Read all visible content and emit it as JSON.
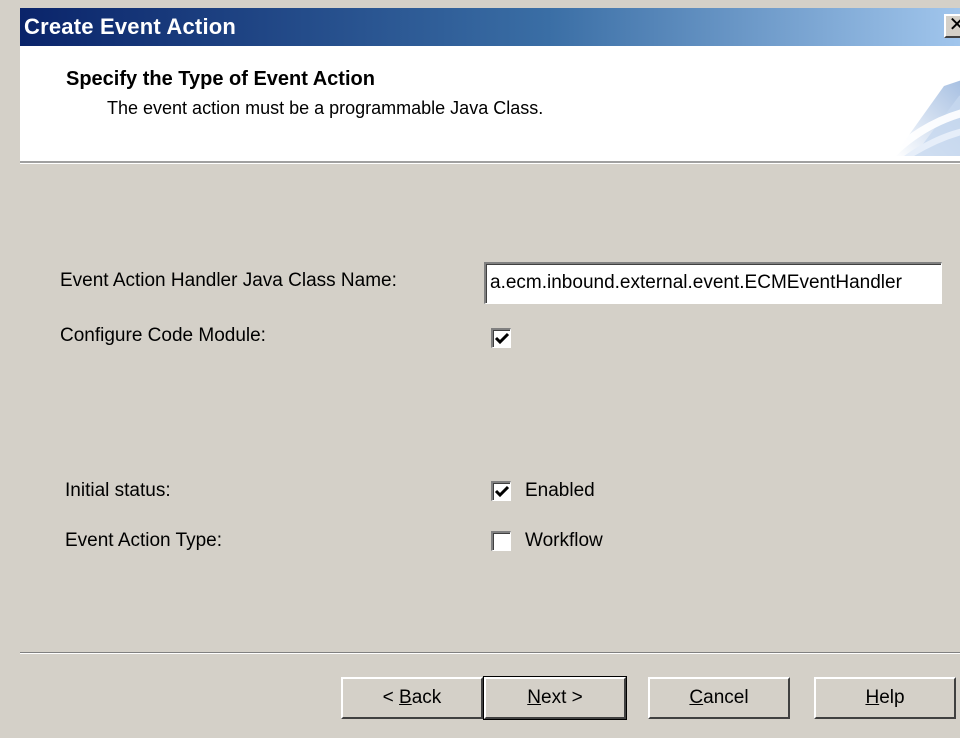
{
  "window": {
    "title": "Create Event Action",
    "close_glyph": "✕"
  },
  "header": {
    "title": "Specify the Type of Event Action",
    "subtitle": "The event action must be a programmable Java Class."
  },
  "form": {
    "handler_label": "Event Action Handler Java Class Name:",
    "handler_value": "a.ecm.inbound.external.event.ECMEventHandler",
    "configure_label": "Configure Code Module:",
    "configure_checked": true,
    "status_label": "Initial status:",
    "status_option_label": "Enabled",
    "status_checked": true,
    "type_label": "Event Action Type:",
    "type_option_label": "Workflow",
    "type_checked": false
  },
  "buttons": {
    "back_prefix": "< ",
    "back_accel": "B",
    "back_rest": "ack",
    "next_accel": "N",
    "next_rest": "ext >",
    "cancel_accel": "C",
    "cancel_rest": "ancel",
    "help_accel": "H",
    "help_rest": "elp"
  },
  "icons": {
    "close": "close-icon",
    "check": "checkmark-icon",
    "header_art": "wizard-banner-icon"
  }
}
